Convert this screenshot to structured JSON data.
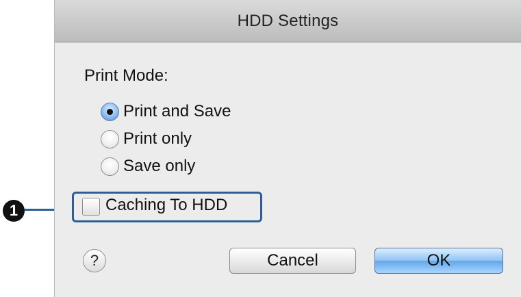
{
  "dialog": {
    "title": "HDD Settings",
    "print_mode_label": "Print Mode:",
    "print_mode_options": [
      {
        "label": "Print and Save",
        "selected": true
      },
      {
        "label": "Print only",
        "selected": false
      },
      {
        "label": "Save only",
        "selected": false
      }
    ],
    "caching_checkbox": {
      "label": "Caching To HDD",
      "checked": false
    },
    "help_symbol": "?",
    "buttons": {
      "cancel": "Cancel",
      "ok": "OK"
    }
  },
  "callout": {
    "number": "1",
    "icon": "numbered-callout-icon"
  },
  "colors": {
    "ok_button": "#63a6ea",
    "highlight_box": "#2b5f97"
  }
}
